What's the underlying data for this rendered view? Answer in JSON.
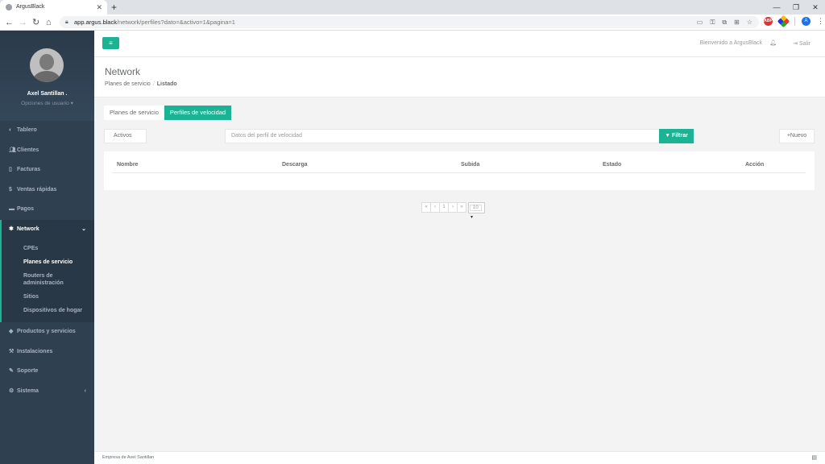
{
  "browser": {
    "tab_title": "ArgusBlack",
    "url_host": "app.argus.black",
    "url_path": "/network/perfiles?dato=&activo=1&pagina=1",
    "ext_label": "ABP",
    "avatar_letter": "A"
  },
  "sidebar": {
    "user_name": "Axel Santillan .",
    "user_options": "Opciones de usuario ▾",
    "items": [
      {
        "label": "Tablero",
        "icon": "dashboard-icon"
      },
      {
        "label": "Clientes",
        "icon": "users-icon"
      },
      {
        "label": "Facturas",
        "icon": "file-icon"
      },
      {
        "label": "Ventas rápidas",
        "icon": "dollar-icon"
      },
      {
        "label": "Pagos",
        "icon": "money-icon"
      },
      {
        "label": "Network",
        "icon": "network-icon"
      },
      {
        "label": "Productos y servicios",
        "icon": "tag-icon"
      },
      {
        "label": "Instalaciones",
        "icon": "wrench-icon"
      },
      {
        "label": "Soporte",
        "icon": "support-icon"
      },
      {
        "label": "Sistema",
        "icon": "cogs-icon"
      }
    ],
    "network_sub": [
      "CPEs",
      "Planes de servicio",
      "Routers de administración",
      "Sitios",
      "Dispositivos de hogar"
    ]
  },
  "topnav": {
    "welcome": "Bienvenido a ArgusBlack",
    "logout": "Salir"
  },
  "page": {
    "title": "Network",
    "breadcrumb_parent": "Planes de servicio",
    "breadcrumb_current": "Listado"
  },
  "tabs": {
    "planes": "Planes de servicio",
    "perfiles": "Perfiles de velocidad"
  },
  "filters": {
    "status": "Activos",
    "search_placeholder": "Datos del perfil de velocidad",
    "filter_button": "Filtrar",
    "new_button": "Nuevo"
  },
  "table": {
    "columns": [
      "Nombre",
      "Descarga",
      "Subida",
      "Estado",
      "Acción"
    ]
  },
  "pager": {
    "first": "«",
    "prev": "‹",
    "page": "1",
    "next": "›",
    "last": "»",
    "page_size": "10"
  },
  "footer": {
    "text": "Empresa de Axel Santillan"
  },
  "colors": {
    "accent": "#1ab394",
    "sidebar": "#2f4050"
  }
}
